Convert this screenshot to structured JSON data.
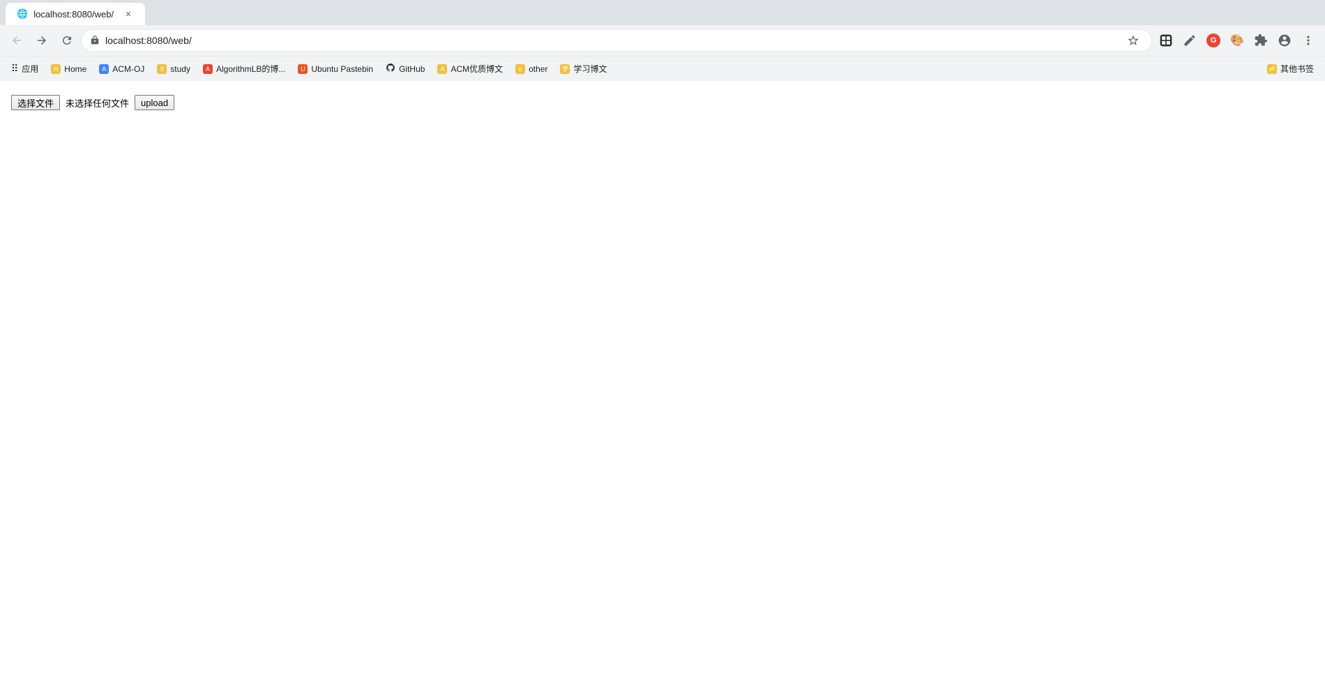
{
  "browser": {
    "tab_title": "localhost:8080/web/",
    "tab_favicon": "🌐"
  },
  "navbar": {
    "back_label": "←",
    "forward_label": "→",
    "reload_label": "↻",
    "address": "localhost:8080/web/",
    "star_label": "☆",
    "extensions_label": "🧩"
  },
  "bookmarks": {
    "items": [
      {
        "id": "apps",
        "label": "应用",
        "type": "apps"
      },
      {
        "id": "home",
        "label": "Home",
        "type": "folder"
      },
      {
        "id": "acm-oj",
        "label": "ACM-OJ",
        "type": "folder"
      },
      {
        "id": "study",
        "label": "study",
        "type": "folder"
      },
      {
        "id": "algorithmLB",
        "label": "AlgorithmLB的博...",
        "type": "site",
        "color": "#ea4335"
      },
      {
        "id": "ubuntu",
        "label": "Ubuntu Pastebin",
        "type": "site",
        "color": "#e95420"
      },
      {
        "id": "github",
        "label": "GitHub",
        "type": "github"
      },
      {
        "id": "acmyou",
        "label": "ACM优质博文",
        "type": "folder"
      },
      {
        "id": "other",
        "label": "other",
        "type": "folder"
      },
      {
        "id": "xuexi",
        "label": "学习博文",
        "type": "folder"
      }
    ],
    "other_label": "其他书签"
  },
  "page": {
    "file_choose_label": "选择文件",
    "file_none_label": "未选择任何文件",
    "upload_label": "upload"
  }
}
